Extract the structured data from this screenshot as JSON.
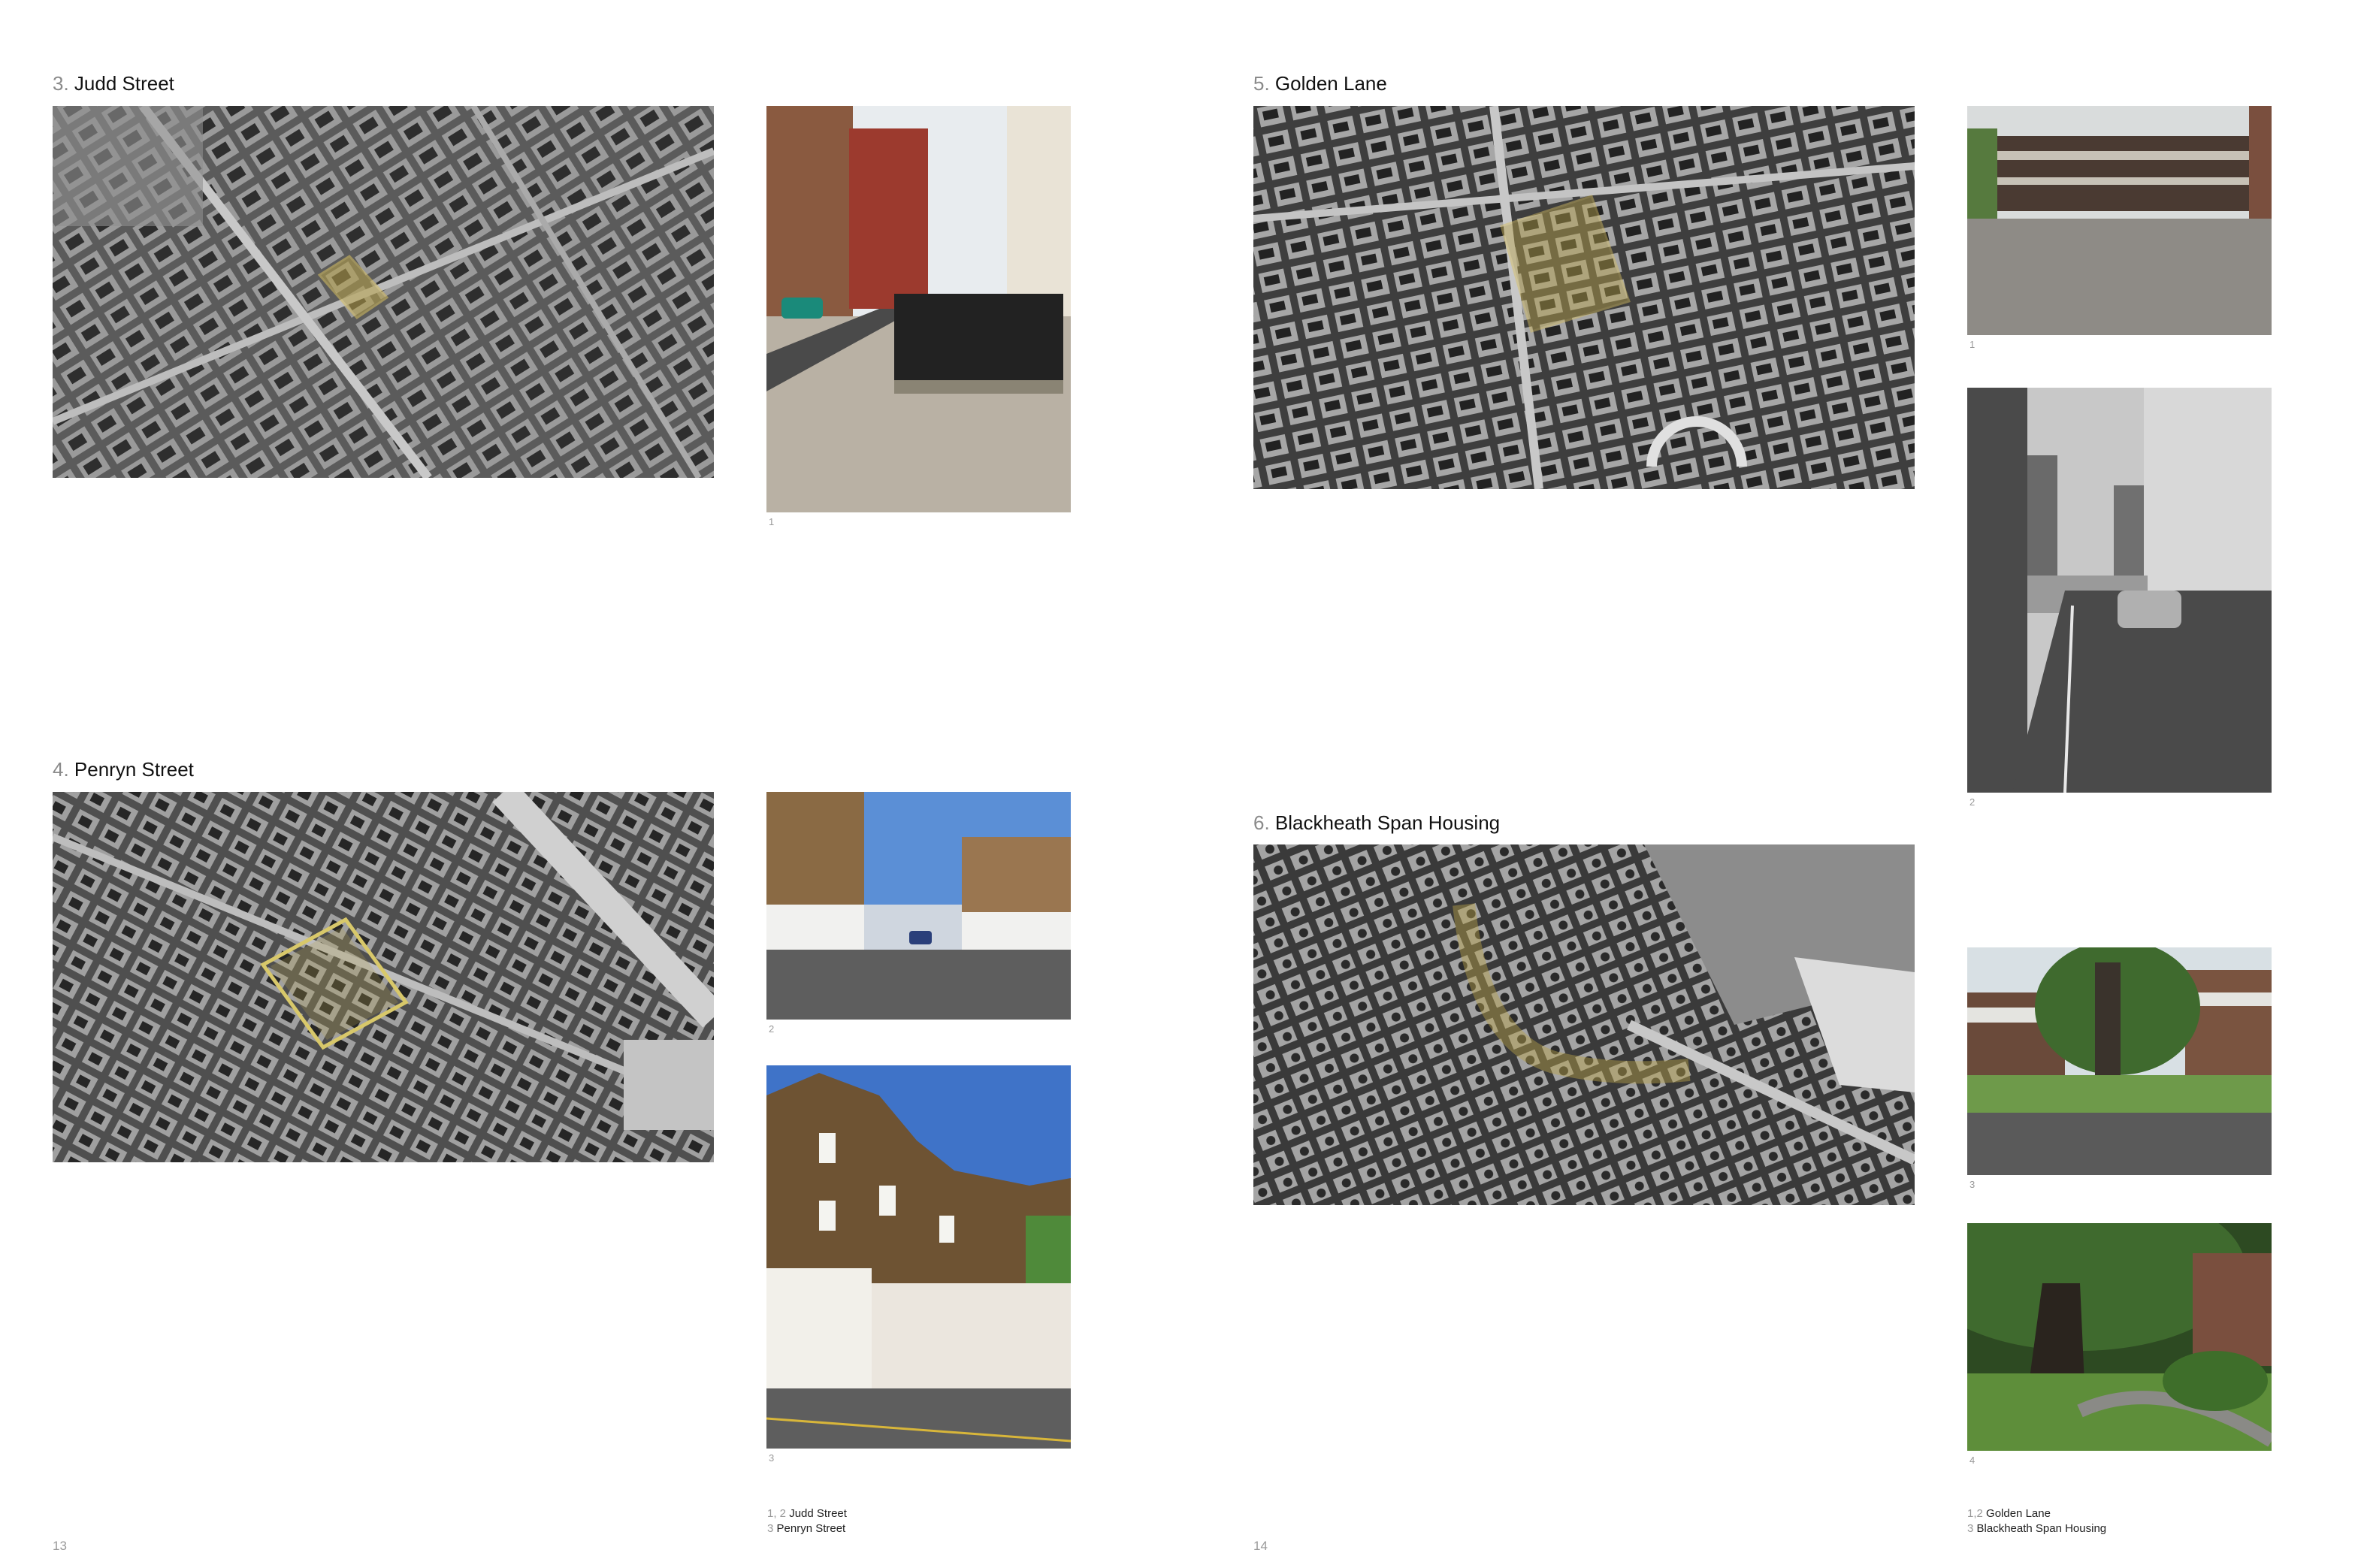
{
  "left_page": {
    "page_number": "13",
    "sections": [
      {
        "number": "3.",
        "title": "Judd Street"
      },
      {
        "number": "4.",
        "title": "Penryn Street"
      }
    ],
    "photo_captions": [
      "1",
      "2",
      "3"
    ],
    "legend": [
      {
        "nums": "1, 2",
        "label": "Judd Street"
      },
      {
        "nums": "3",
        "label": "Penryn Street"
      }
    ]
  },
  "right_page": {
    "page_number": "14",
    "sections": [
      {
        "number": "5.",
        "title": "Golden Lane"
      },
      {
        "number": "6.",
        "title": "Blackheath Span Housing"
      }
    ],
    "photo_captions": [
      "1",
      "2",
      "3",
      "4"
    ],
    "legend": [
      {
        "nums": "1,2",
        "label": "Golden Lane"
      },
      {
        "nums": "3",
        "label": "Blackheath Span Housing"
      }
    ]
  },
  "colors": {
    "heading_number": "#8a8a8a",
    "highlight": "#b8a24a",
    "caption": "#999999"
  }
}
